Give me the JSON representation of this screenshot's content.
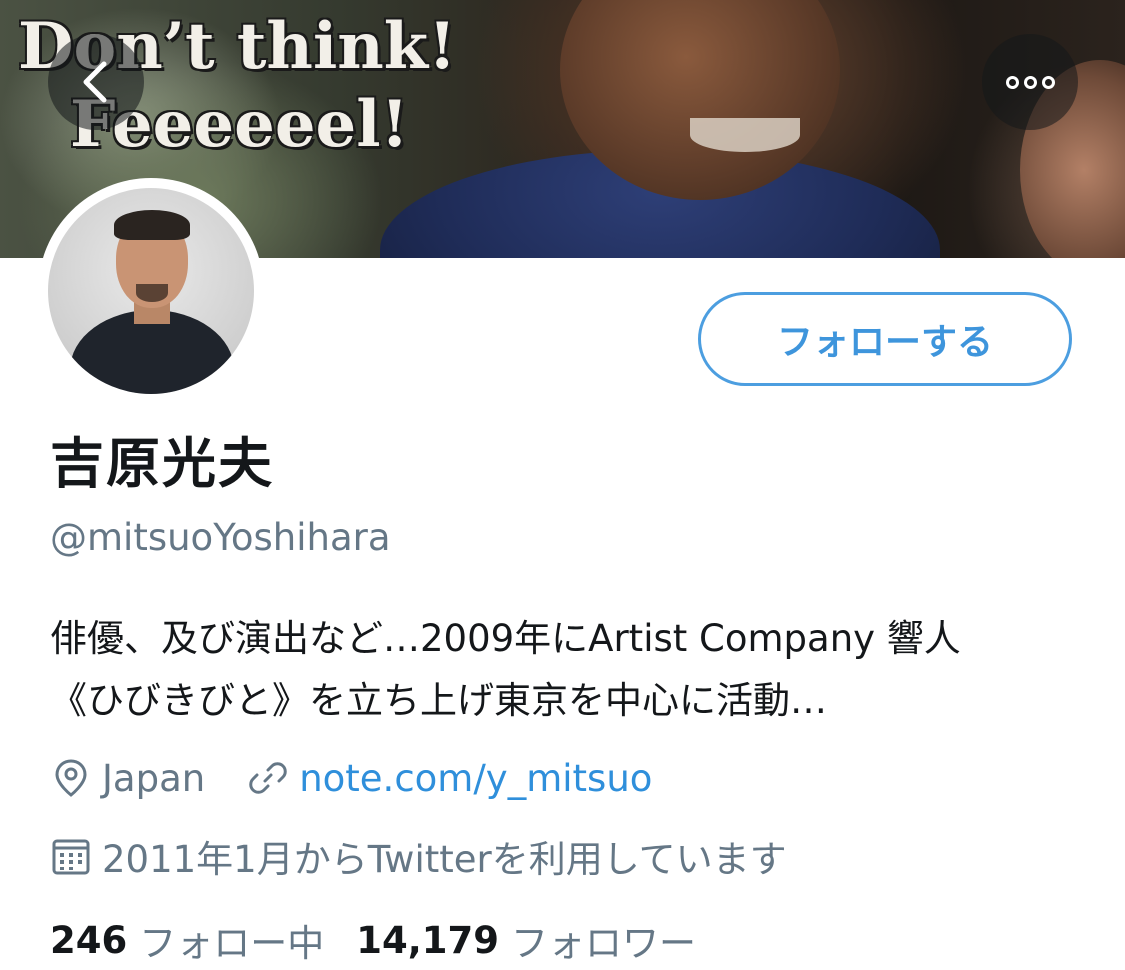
{
  "header": {
    "banner_caption_line1": "Don’t think!",
    "banner_caption_line2": "Feeeeeel!",
    "back_icon": "chevron-left-icon",
    "more_icon": "more-dots-icon"
  },
  "profile": {
    "avatar": "profile-avatar",
    "follow_button_label": "フォローする",
    "display_name": "吉原光夫",
    "handle": "@mitsuoYoshihara",
    "bio_line1": "俳優、及び演出など…2009年にArtist Company 響人",
    "bio_line2": "《ひびきびと》を立ち上げ東京を中心に活動…",
    "location_icon": "location-pin-icon",
    "location": "Japan",
    "link_icon": "link-icon",
    "website": "note.com/y_mitsuo",
    "calendar_icon": "calendar-icon",
    "joined": "2011年1月からTwitterを利用しています",
    "following_count": "246",
    "following_label": "フォロー中",
    "followers_count": "14,179",
    "followers_label": "フォロワー"
  },
  "colors": {
    "accent": "#3e95dc",
    "secondary_text": "#657786",
    "primary_text": "#14171a"
  }
}
